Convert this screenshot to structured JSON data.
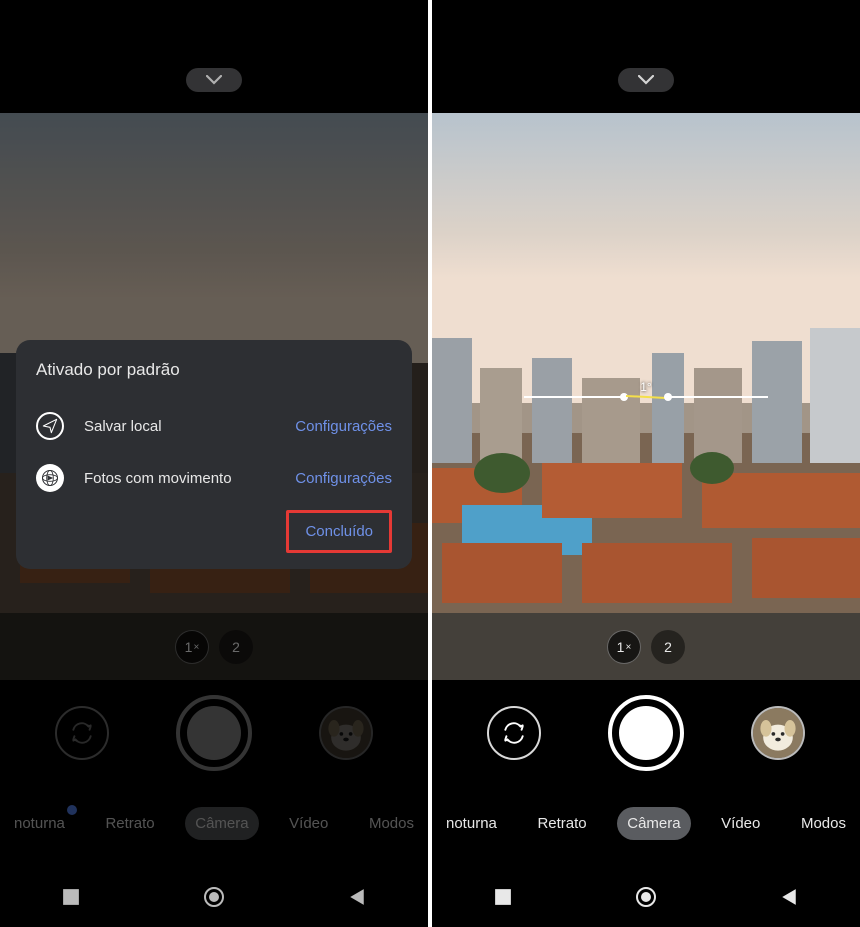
{
  "left": {
    "top_pill_icon": "chevron-down",
    "zoom": {
      "options": [
        {
          "label": "1",
          "mult": "×",
          "active": true
        },
        {
          "label": "2",
          "mult": "",
          "active": false
        }
      ]
    },
    "controls": {
      "switch_icon": "flip-camera",
      "shutter": "shutter",
      "gallery": "last-photo-thumb"
    },
    "modes": [
      {
        "label": "noturna",
        "notif": true,
        "active": false
      },
      {
        "label": "Retrato",
        "notif": false,
        "active": false
      },
      {
        "label": "Câmera",
        "notif": false,
        "active": true
      },
      {
        "label": "Vídeo",
        "notif": false,
        "active": false
      },
      {
        "label": "Modos",
        "notif": false,
        "active": false
      }
    ],
    "nav": {
      "recents": "square",
      "home": "home",
      "back": "back-triangle"
    },
    "dialog": {
      "title": "Ativado por padrão",
      "rows": [
        {
          "icon": "paper-plane",
          "label": "Salvar local",
          "action": "Configurações"
        },
        {
          "icon": "motion-globe",
          "label": "Fotos com movimento",
          "action": "Configurações"
        }
      ],
      "done_label": "Concluído",
      "done_highlight": true
    }
  },
  "right": {
    "top_pill_icon": "chevron-down",
    "level": {
      "degree": "1°"
    },
    "zoom": {
      "options": [
        {
          "label": "1",
          "mult": "×",
          "active": true
        },
        {
          "label": "2",
          "mult": "",
          "active": false
        }
      ]
    },
    "controls": {
      "switch_icon": "flip-camera",
      "shutter": "shutter",
      "gallery": "last-photo-thumb"
    },
    "modes": [
      {
        "label": "noturna",
        "notif": false,
        "active": false
      },
      {
        "label": "Retrato",
        "notif": false,
        "active": false
      },
      {
        "label": "Câmera",
        "notif": false,
        "active": true
      },
      {
        "label": "Vídeo",
        "notif": false,
        "active": false
      },
      {
        "label": "Modos",
        "notif": false,
        "active": false
      }
    ],
    "nav": {
      "recents": "square",
      "home": "home",
      "back": "back-triangle"
    }
  }
}
